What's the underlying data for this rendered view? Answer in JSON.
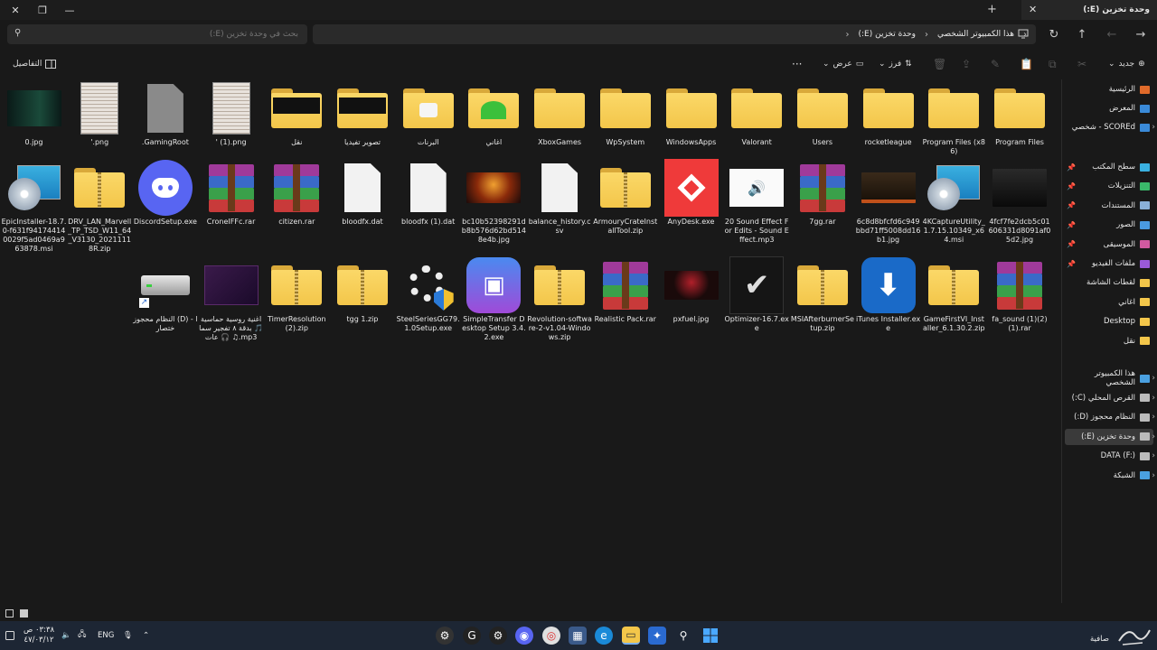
{
  "window": {
    "tab_title": "وحدة تخزين (E:)",
    "close_glyph": "✕",
    "restore_glyph": "❐",
    "minimize_glyph": "—",
    "newtab_glyph": "+"
  },
  "address": {
    "search_placeholder": "بحث في وحدة تخزين (E:)",
    "breadcrumb": [
      "هذا الكمبيوتر الشخصي",
      "وحدة تخزين (E:)"
    ]
  },
  "toolbar": {
    "new_label": "جديد",
    "sort_label": "فرز",
    "view_label": "عرض",
    "more_glyph": "···",
    "details_label": "التفاصيل"
  },
  "files": [
    {
      "name": "Program Files",
      "type": "folder"
    },
    {
      "name": "Program Files (x86)",
      "type": "folder"
    },
    {
      "name": "rocketleague",
      "type": "folder"
    },
    {
      "name": "Users",
      "type": "folder"
    },
    {
      "name": "Valorant",
      "type": "folder"
    },
    {
      "name": "WindowsApps",
      "type": "folder"
    },
    {
      "name": "WpSystem",
      "type": "folder"
    },
    {
      "name": "XboxGames",
      "type": "folder"
    },
    {
      "name": "اغاني",
      "type": "folder-green"
    },
    {
      "name": "البرنات",
      "type": "folder-white"
    },
    {
      "name": "تصوير تفيديا",
      "type": "folder-dark"
    },
    {
      "name": "نقل",
      "type": "folder-dark"
    },
    {
      "name": "' (1).png",
      "type": "doc-image"
    },
    {
      "name": ".GamingRoot",
      "type": "gray-file"
    },
    {
      "name": "'.png",
      "type": "doc-image"
    },
    {
      "name": "0.jpg",
      "type": "photo-green"
    },
    {
      "name": "4fcf7fe2dcb5c01606331d8091af05d2.jpg",
      "type": "photo-dark"
    },
    {
      "name": "4KCaptureUtility_1.7.15.10349_x64.msi",
      "type": "msi"
    },
    {
      "name": "6c8d8bfcfd6c949bbd71ff5008dd16b1.jpg",
      "type": "photo-ruins"
    },
    {
      "name": "7gg.rar",
      "type": "rar"
    },
    {
      "name": "20 Sound Effect For Edits - Sound Effect.mp3",
      "type": "mp3-white"
    },
    {
      "name": "AnyDesk.exe",
      "type": "anydesk"
    },
    {
      "name": "ArmouryCrateInstallTool.zip",
      "type": "zip"
    },
    {
      "name": "balance_history.csv",
      "type": "blank"
    },
    {
      "name": "bc10b52398291db8b576d62bd5148e4b.jpg",
      "type": "photo-fire"
    },
    {
      "name": "bloodfx (1).dat",
      "type": "blank"
    },
    {
      "name": "bloodfx.dat",
      "type": "blank"
    },
    {
      "name": "citizen.rar",
      "type": "rar"
    },
    {
      "name": "CroneIFFc.rar",
      "type": "rar"
    },
    {
      "name": "DiscordSetup.exe",
      "type": "discord"
    },
    {
      "name": "DRV_LAN_Marvell_TP_TSD_W11_64_V3130_20211118R.zip",
      "type": "zip"
    },
    {
      "name": "EpicInstaller-18.7.0-f631f94174414 0029f5ad0469a963878.msi",
      "type": "msi"
    },
    {
      "name": "fa_sound (1)(2)(1).rar",
      "type": "rar"
    },
    {
      "name": "GameFirstVI_Installer_6.1.30.2.zip",
      "type": "zip"
    },
    {
      "name": "iTunes Installer.exe",
      "type": "itunes"
    },
    {
      "name": "MSIAfterburnerSetup.zip",
      "type": "zip"
    },
    {
      "name": "Optimizer-16.7.exe",
      "type": "optimizer"
    },
    {
      "name": "pxfuel.jpg",
      "type": "photo-red"
    },
    {
      "name": "Realistic Pack.rar",
      "type": "rar"
    },
    {
      "name": "Revolution-software-2-v1.04-Windows.zip",
      "type": "zip"
    },
    {
      "name": "SimpleTransfer Desktop Setup 3.4.2.exe",
      "type": "simpletransfer"
    },
    {
      "name": "SteelSeriesGG79.1.0Setup.exe",
      "type": "steelseries"
    },
    {
      "name": "tgg 1.zip",
      "type": "zip"
    },
    {
      "name": "TimerResolution (2).zip",
      "type": "zip"
    },
    {
      "name": "اغنية روسية حماسية 🎵 بدقة ٨ تفجير سماعات 🎧 ♫.mp3",
      "type": "mp3-purple"
    },
    {
      "name": "النظام محجوز (D) - اختصار",
      "type": "drive-shortcut"
    }
  ],
  "nav": {
    "quick": [
      {
        "label": "الرئيسية",
        "color": "#e06a2a"
      },
      {
        "label": "المعرض",
        "color": "#3a8ad8"
      },
      {
        "label": "SCOREd - شخصي",
        "color": "#3a8ad8"
      }
    ],
    "pinned": [
      {
        "label": "سطح المكتب",
        "color": "#3ab0e0"
      },
      {
        "label": "التنزيلات",
        "color": "#3ab86a"
      },
      {
        "label": "المستندات",
        "color": "#8ab0d8"
      },
      {
        "label": "الصور",
        "color": "#4a9ae0"
      },
      {
        "label": "الموسيقى",
        "color": "#d05aa0"
      },
      {
        "label": "ملفات الفيديو",
        "color": "#9a5ad8"
      },
      {
        "label": "لقطات الشاشة",
        "color": "#f3c64a"
      },
      {
        "label": "اغاني",
        "color": "#f3c64a"
      },
      {
        "label": "Desktop",
        "color": "#f3c64a"
      },
      {
        "label": "نقل",
        "color": "#f3c64a"
      }
    ],
    "pc": [
      {
        "label": "هذا الكمبيوتر الشخصي",
        "color": "#4aa0e0"
      },
      {
        "label": "القرص المحلي (C:)",
        "color": "#bbbbbb"
      },
      {
        "label": "النظام محجوز (D:)",
        "color": "#bbbbbb"
      },
      {
        "label": "وحدة تخزين (E:)",
        "color": "#bbbbbb"
      },
      {
        "label": "DATA (F:)",
        "color": "#bbbbbb"
      },
      {
        "label": "الشبكة",
        "color": "#4aa0e0"
      }
    ]
  },
  "taskbar": {
    "lang": "ENG",
    "time": "٠٣:٣٨ ص",
    "date": "٤٧/٠٣/١٢",
    "brand": "صافية"
  }
}
